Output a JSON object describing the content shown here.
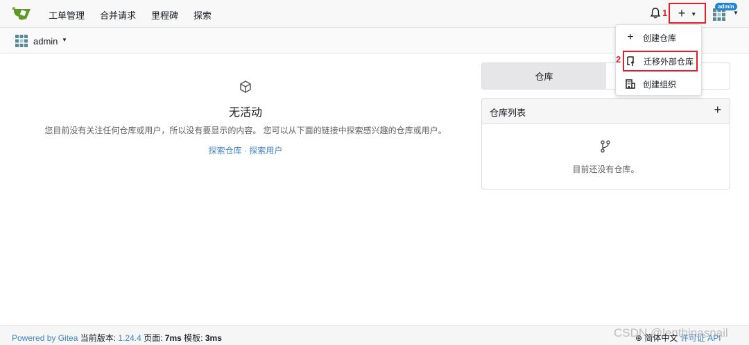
{
  "nav": {
    "items": [
      "工单管理",
      "合并请求",
      "里程碑",
      "探索"
    ],
    "annotation_1": "1",
    "avatar_badge": "admin"
  },
  "subbar": {
    "username": "admin"
  },
  "feed": {
    "title": "无活动",
    "description": "您目前没有关注任何仓库或用户，所以没有要显示的内容。 您可以从下面的链接中探索感兴趣的仓库或用户。",
    "explore_repos": "探索仓库",
    "separator": " · ",
    "explore_users": "探索用户"
  },
  "right_panel": {
    "tab_repos": "仓库",
    "list_title": "仓库列表",
    "list_add": "+",
    "empty_text": "目前还没有仓库。"
  },
  "menu": {
    "annotation_2": "2",
    "items": [
      "创建仓库",
      "迁移外部仓库",
      "创建组织"
    ]
  },
  "footer": {
    "powered": "Powered by Gitea",
    "version_label": " 当前版本: ",
    "version": "1.24.4",
    "page_label": " 页面: ",
    "page_time": "7ms",
    "tpl_label": " 模板: ",
    "tpl_time": "3ms",
    "language": "简体中文",
    "license": "许可证",
    "api": "API"
  },
  "watermark": "CSDN @lenthinasnail",
  "colors": {
    "accent_red": "#e0212b",
    "link_blue": "#4183c4",
    "gitea_green": "#609926"
  }
}
